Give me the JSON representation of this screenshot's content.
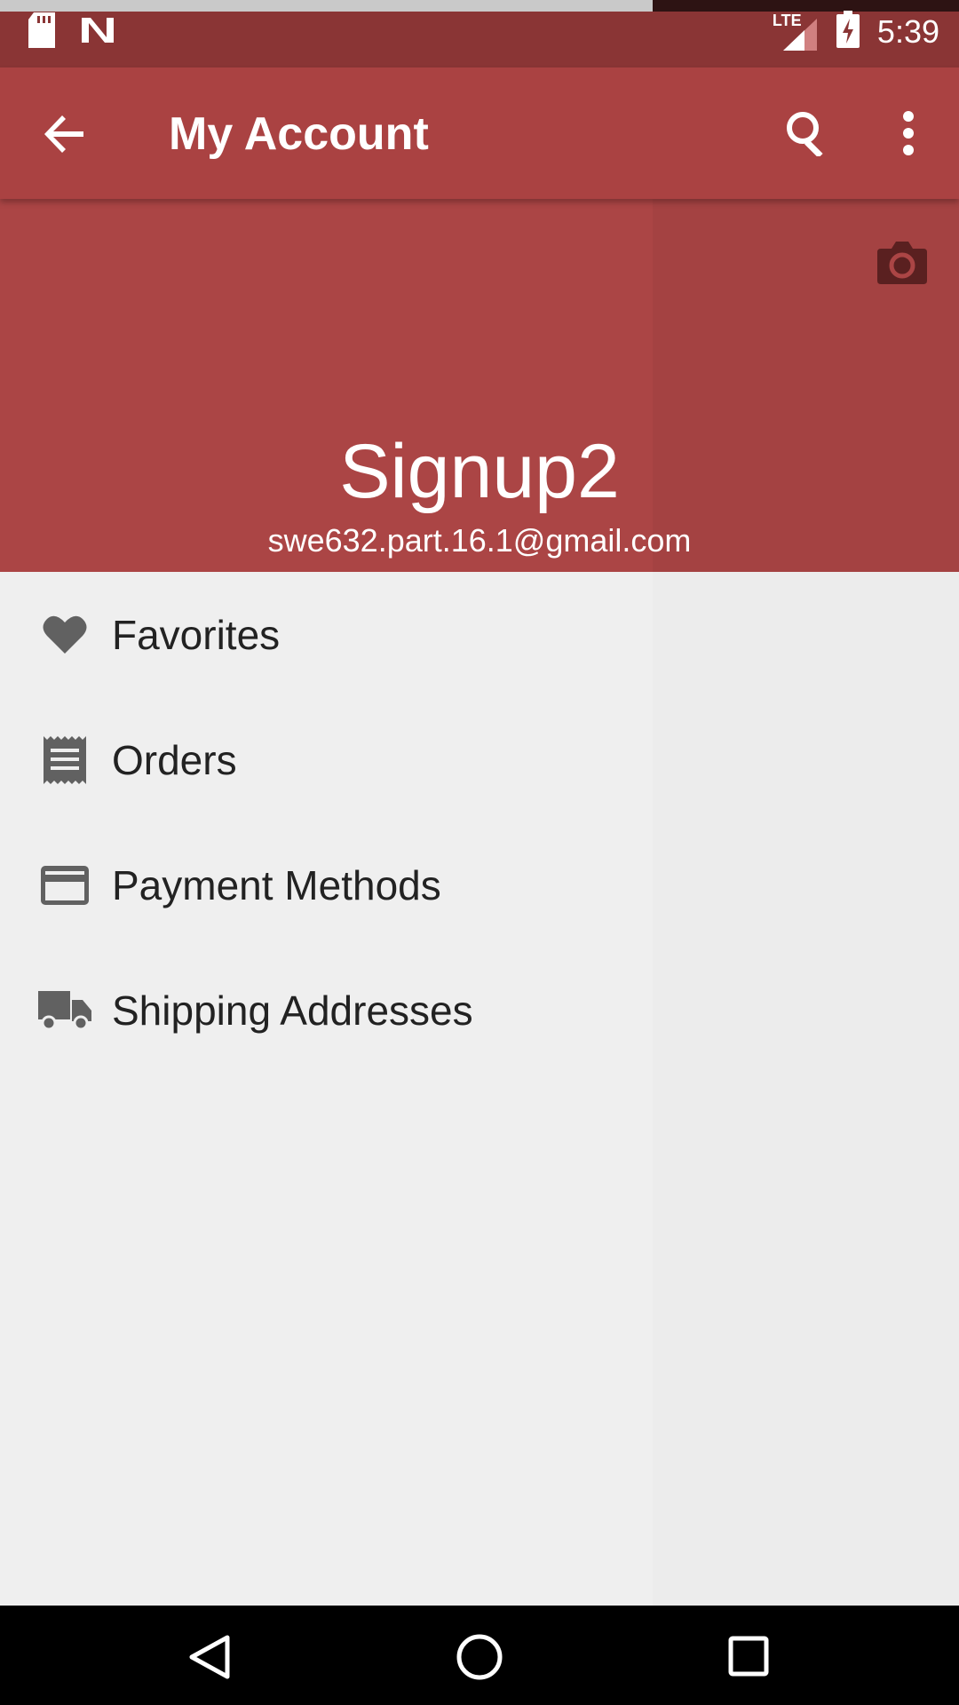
{
  "status_bar": {
    "time": "5:39",
    "network_label": "LTE",
    "icons": [
      "sd-card-icon",
      "n-notification-icon",
      "lte-signal-icon",
      "battery-charging-icon"
    ]
  },
  "app_bar": {
    "title": "My Account",
    "icons": [
      "back-arrow-icon",
      "search-icon",
      "more-vert-icon"
    ]
  },
  "profile_header": {
    "name": "Signup2",
    "email": "swe632.part.16.1@gmail.com",
    "icon": "camera-icon"
  },
  "menu": {
    "items": [
      {
        "label": "Favorites",
        "icon": "heart-icon"
      },
      {
        "label": "Orders",
        "icon": "receipt-icon"
      },
      {
        "label": "Payment Methods",
        "icon": "credit-card-icon"
      },
      {
        "label": "Shipping Addresses",
        "icon": "truck-icon"
      }
    ]
  },
  "nav_bar": {
    "icons": [
      "nav-back-icon",
      "nav-home-icon",
      "nav-recents-icon"
    ]
  },
  "colors": {
    "app_bar": "#aa4242",
    "status_bar": "#8a3535",
    "menu_text": "#222222",
    "icon_gray": "#616161"
  }
}
